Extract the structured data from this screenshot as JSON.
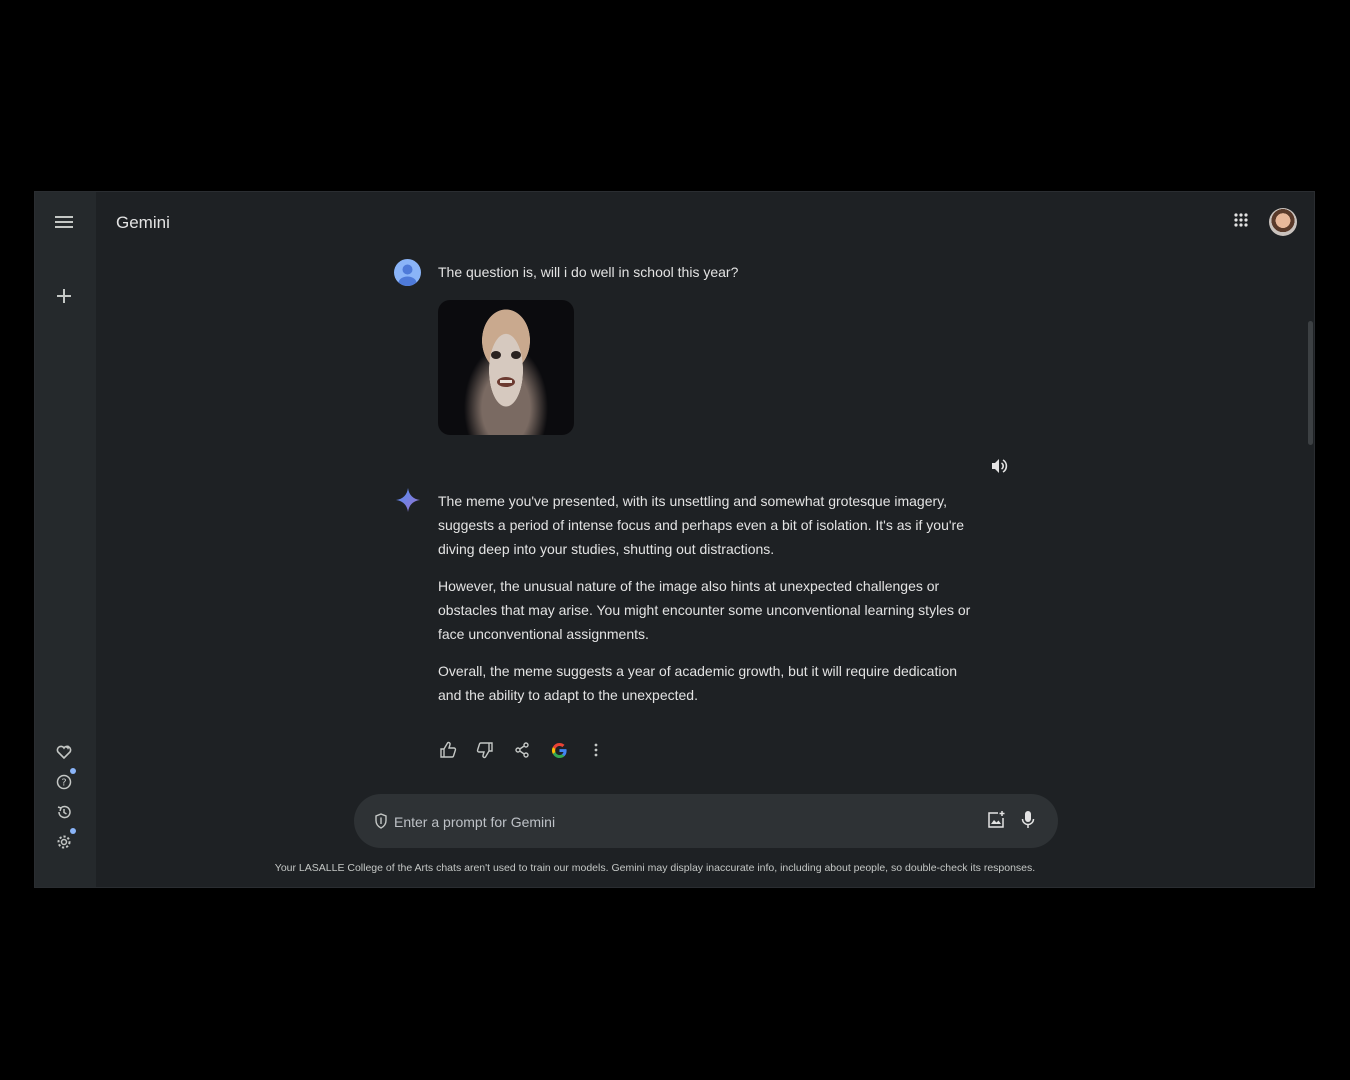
{
  "app": {
    "title": "Gemini"
  },
  "chat": {
    "user_message": "The question is, will i do well in school this year?",
    "response_paragraphs": [
      "The meme you've presented, with its unsettling and somewhat grotesque imagery, suggests a period of intense focus and perhaps even a bit of isolation. It's as if you're diving deep into your studies, shutting out distractions.",
      "However, the unusual nature of the image also hints at unexpected challenges or obstacles that may arise. You might encounter some unconventional learning styles or face unconventional assignments.",
      "Overall, the meme suggests a year of academic growth, but it will require dedication and the ability to adapt to the unexpected."
    ]
  },
  "prompt": {
    "placeholder": "Enter a prompt for Gemini"
  },
  "footer": {
    "disclaimer": "Your LASALLE College of the Arts chats aren't used to train our models. Gemini may display inaccurate info, including about people, so double-check its responses."
  },
  "icons": {
    "menu": "menu-icon",
    "new_chat": "plus-icon",
    "gem": "gem-manager-icon",
    "help": "help-icon",
    "activity": "history-icon",
    "settings": "gear-icon",
    "apps": "apps-grid-icon",
    "speaker": "speaker-icon",
    "sparkle": "gemini-sparkle-icon",
    "thumb_up": "thumb-up-icon",
    "thumb_down": "thumb-down-icon",
    "share": "share-icon",
    "google": "google-g-icon",
    "more": "more-vert-icon",
    "image_upload": "add-image-icon",
    "mic": "mic-icon"
  },
  "colors": {
    "accent": "#8ab4f8",
    "background": "#1e2124",
    "rail": "#25292c"
  }
}
